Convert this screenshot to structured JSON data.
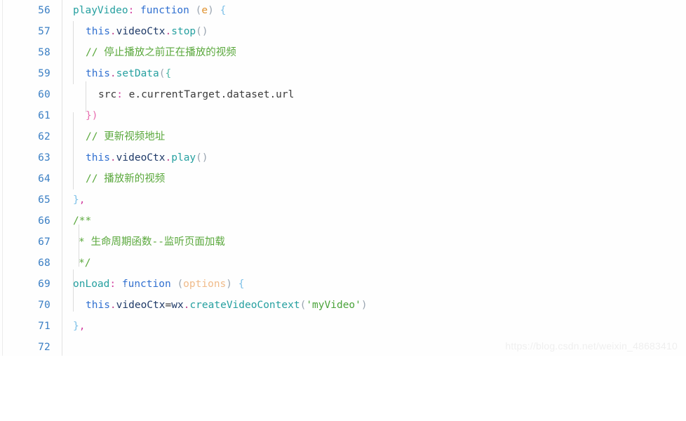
{
  "editor": {
    "first_line_number": 56,
    "last_line_number": 72,
    "line_height_px": 30,
    "colors": {
      "background": "#fefefe",
      "gutter_text": "#3b7fc4",
      "gutter_divider": "#e3e3e3",
      "indent_guide": "#dcdcdc",
      "comment": "#5aa83c",
      "keyword": "#2f6fd0",
      "property": "#26a0a0",
      "punctuation": "#d23fa0",
      "string": "#4aa33a",
      "identifier": "#1f3a68",
      "parameter": "#e0922f",
      "paren": "#9aa5b1",
      "brace": "#7cc0e8",
      "plain_text": "#3b3b3b",
      "watermark": "#efefef"
    },
    "lines": [
      {
        "number": "56",
        "text": "playVideo: function (e) {"
      },
      {
        "number": "57",
        "text": "  this.videoCtx.stop()"
      },
      {
        "number": "58",
        "text": "  // 停止播放之前正在播放的视频"
      },
      {
        "number": "59",
        "text": "  this.setData({"
      },
      {
        "number": "60",
        "text": "    src: e.currentTarget.dataset.url"
      },
      {
        "number": "61",
        "text": "  })"
      },
      {
        "number": "62",
        "text": "  // 更新视频地址"
      },
      {
        "number": "63",
        "text": "  this.videoCtx.play()"
      },
      {
        "number": "64",
        "text": "  // 播放新的视频"
      },
      {
        "number": "65",
        "text": "},"
      },
      {
        "number": "66",
        "text": "/**"
      },
      {
        "number": "67",
        "text": " * 生命周期函数--监听页面加载"
      },
      {
        "number": "68",
        "text": " */"
      },
      {
        "number": "69",
        "text": "onLoad: function (options) {"
      },
      {
        "number": "70",
        "text": "  this.videoCtx=wx.createVideoContext('myVideo')"
      },
      {
        "number": "71",
        "text": "},"
      },
      {
        "number": "72",
        "text": ""
      }
    ],
    "tokens": {
      "l56": {
        "prop": "playVideo",
        "colon": ":",
        "kw": "function",
        "open_paren": "(",
        "param": "e",
        "close_paren": ")",
        "brace": "{"
      },
      "l57": {
        "kw": "this",
        "dot1": ".",
        "ident": "videoCtx",
        "dot2": ".",
        "method": "stop",
        "parens": "()"
      },
      "l58": {
        "comment": "// 停止播放之前正在播放的视频"
      },
      "l59": {
        "kw": "this",
        "dot": ".",
        "method": "setData",
        "paren": "(",
        "brace": "{"
      },
      "l60": {
        "key": "src",
        "colon": ":",
        "value": " e.currentTarget.dataset.url"
      },
      "l61": {
        "close": "})"
      },
      "l62": {
        "comment": "// 更新视频地址"
      },
      "l63": {
        "kw": "this",
        "dot1": ".",
        "ident": "videoCtx",
        "dot2": ".",
        "method": "play",
        "parens": "()"
      },
      "l64": {
        "comment": "// 播放新的视频"
      },
      "l65": {
        "brace": "}",
        "comma": ","
      },
      "l66": {
        "comment": "/**"
      },
      "l67": {
        "comment": "* 生命周期函数--监听页面加载"
      },
      "l68": {
        "comment": "*/"
      },
      "l69": {
        "prop": "onLoad",
        "colon": ":",
        "kw": "function",
        "open_paren": "(",
        "param": "options",
        "close_paren": ")",
        "brace": "{"
      },
      "l70": {
        "kw": "this",
        "dot1": ".",
        "ident": "videoCtx",
        "op": "=",
        "ident2": "wx",
        "dot2": ".",
        "method": "createVideoContext",
        "open_paren": "(",
        "string": "'myVideo'",
        "close_paren": ")"
      },
      "l71": {
        "brace": "}",
        "comma": ","
      }
    },
    "artifact": "..."
  },
  "watermark": {
    "text": "https://blog.csdn.net/weixin_48683410"
  }
}
